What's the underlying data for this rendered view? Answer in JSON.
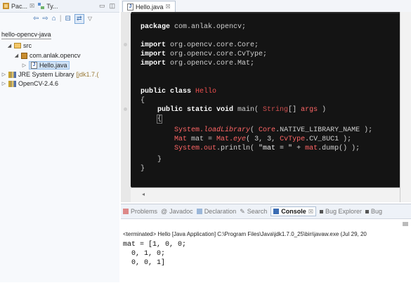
{
  "left_panel": {
    "tabs": [
      {
        "label": "Pac...",
        "close": "☒"
      },
      {
        "label": "Ty..."
      }
    ],
    "project": "hello-opencv-java",
    "tree": {
      "src": "src",
      "package": "com.anlak.opencv",
      "file": "Hello.java",
      "jre_label": "JRE System Library",
      "jre_version": "[jdk1.7.(",
      "opencv": "OpenCV-2.4.6"
    }
  },
  "editor": {
    "tab": {
      "label": "Hello.java",
      "close": "☒"
    },
    "code": {
      "l1": {
        "kw": "package",
        "rest": " com.anlak.opencv;"
      },
      "l2": {
        "kw": "import",
        "rest": " org.opencv.core.Core;"
      },
      "l3": {
        "kw": "import",
        "rest": " org.opencv.core.CvType;"
      },
      "l4": {
        "kw": "import",
        "rest": " org.opencv.core.Mat;"
      },
      "l5": {
        "kw": "public class",
        "name": " Hello"
      },
      "l6": "{",
      "l7": {
        "kw": "public static void",
        "m": " main(",
        "t": " String",
        "r": "[] ",
        "a": "args",
        "e": " )"
      },
      "l8": "{",
      "l9": {
        "a": "System.",
        "b": "loadLibrary",
        "c": "( ",
        "d": "Core",
        "e": ".NATIVE_LIBRARY_NAME );"
      },
      "l10": {
        "a": "Mat",
        "b": " mat = ",
        "c": "Mat.",
        "d": "eye",
        "e": "( 3, 3, ",
        "f": "CvType",
        "g": ".CV_8UC1 );"
      },
      "l11": {
        "a": "System.",
        "b": "out",
        "c": ".println( ",
        "d": "\"mat = \"",
        "e": " + ",
        "f": "mat",
        "g": ".dump() );"
      },
      "l12": "}",
      "l13": "}"
    }
  },
  "bottom_panel": {
    "tabs": [
      "Problems",
      "Javadoc",
      "Declaration",
      "Search",
      "Console",
      "Bug Explorer",
      "Bug"
    ],
    "console_close": "☒",
    "terminated": "<terminated> Hello [Java Application] C:\\Program Files\\Java\\jdk1.7.0_25\\bin\\javaw.exe (Jul 29, 20",
    "output": [
      "mat = [1, 0, 0;",
      "  0, 1, 0;",
      "  0, 0, 1]"
    ]
  }
}
